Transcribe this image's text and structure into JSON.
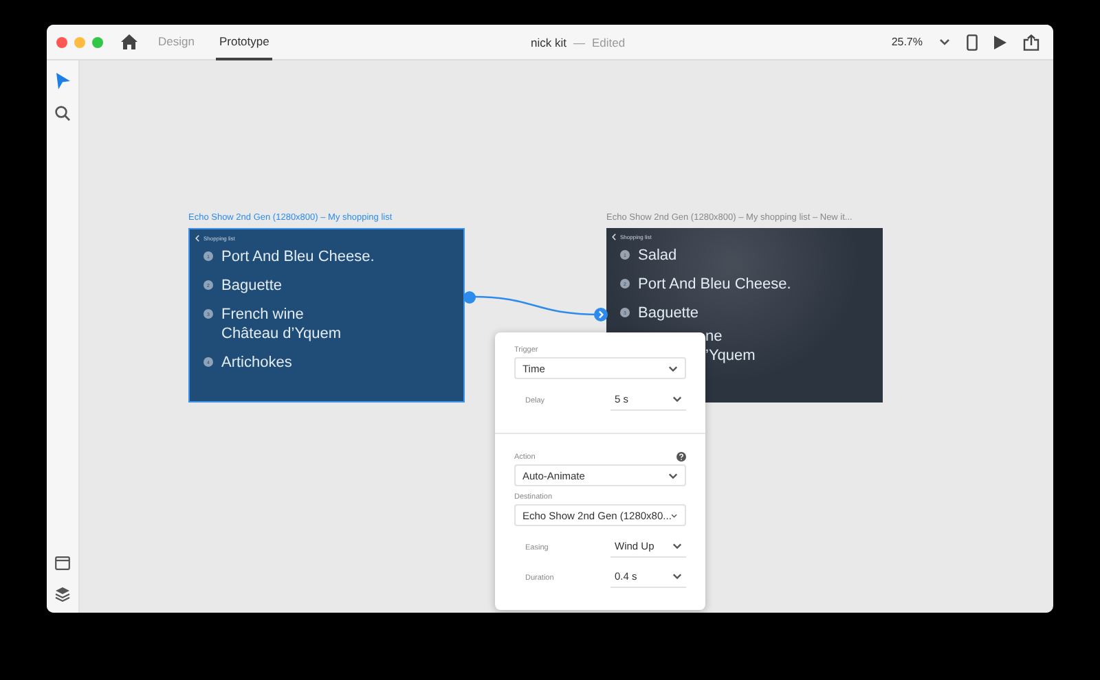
{
  "window": {
    "title": "nick kit",
    "separator": "—",
    "status": "Edited"
  },
  "tabs": [
    {
      "label": "Design",
      "selected": false
    },
    {
      "label": "Prototype",
      "selected": true
    }
  ],
  "zoom": {
    "value": "25.7%"
  },
  "tools": [
    {
      "kind": "pointer",
      "selected": true
    },
    {
      "kind": "search",
      "selected": false
    }
  ],
  "bottom_tools": [
    {
      "kind": "assets"
    },
    {
      "kind": "layers"
    }
  ],
  "artboards": [
    {
      "label": "Echo Show 2nd Gen (1280x800)  – My shopping list",
      "selected": true,
      "color": "#1f4d78",
      "header": "Shopping list",
      "items": [
        {
          "kind": "numbered",
          "number": "1",
          "lines": [
            "Port And Bleu Cheese."
          ]
        },
        {
          "kind": "numbered",
          "number": "2",
          "lines": [
            "Baguette"
          ]
        },
        {
          "kind": "numbered",
          "number": "3",
          "lines": [
            "French wine",
            "Château d’Yquem"
          ]
        },
        {
          "kind": "numbered",
          "number": "4",
          "lines": [
            "Artichokes"
          ]
        }
      ]
    },
    {
      "label": "Echo Show 2nd Gen (1280x800)  – My shopping list – New it...",
      "selected": false,
      "color": "#2c3440",
      "header": "Shopping list",
      "items": [
        {
          "kind": "numbered",
          "number": "1",
          "lines": [
            "Salad"
          ]
        },
        {
          "kind": "numbered",
          "number": "2",
          "lines": [
            "Port And Bleu Cheese."
          ]
        },
        {
          "kind": "numbered",
          "number": "3",
          "lines": [
            "Baguette"
          ]
        },
        {
          "kind": "partial",
          "lines": [
            "ne",
            "’Yquem"
          ]
        }
      ]
    }
  ],
  "popup": {
    "sections": [
      {
        "rows": [
          {
            "kind": "label",
            "text": "Trigger",
            "help": false
          },
          {
            "kind": "select",
            "value": "Time"
          },
          {
            "kind": "pair",
            "label": "Delay",
            "value": "5 s"
          }
        ]
      },
      {
        "rows": [
          {
            "kind": "label",
            "text": "Action",
            "help": true
          },
          {
            "kind": "select",
            "value": "Auto-Animate"
          },
          {
            "kind": "label",
            "text": "Destination",
            "help": false
          },
          {
            "kind": "select",
            "value": "Echo Show 2nd Gen (1280x80..."
          },
          {
            "kind": "pair",
            "label": "Easing",
            "value": "Wind Up"
          },
          {
            "kind": "pair",
            "label": "Duration",
            "value": "0.4 s"
          }
        ]
      }
    ]
  }
}
